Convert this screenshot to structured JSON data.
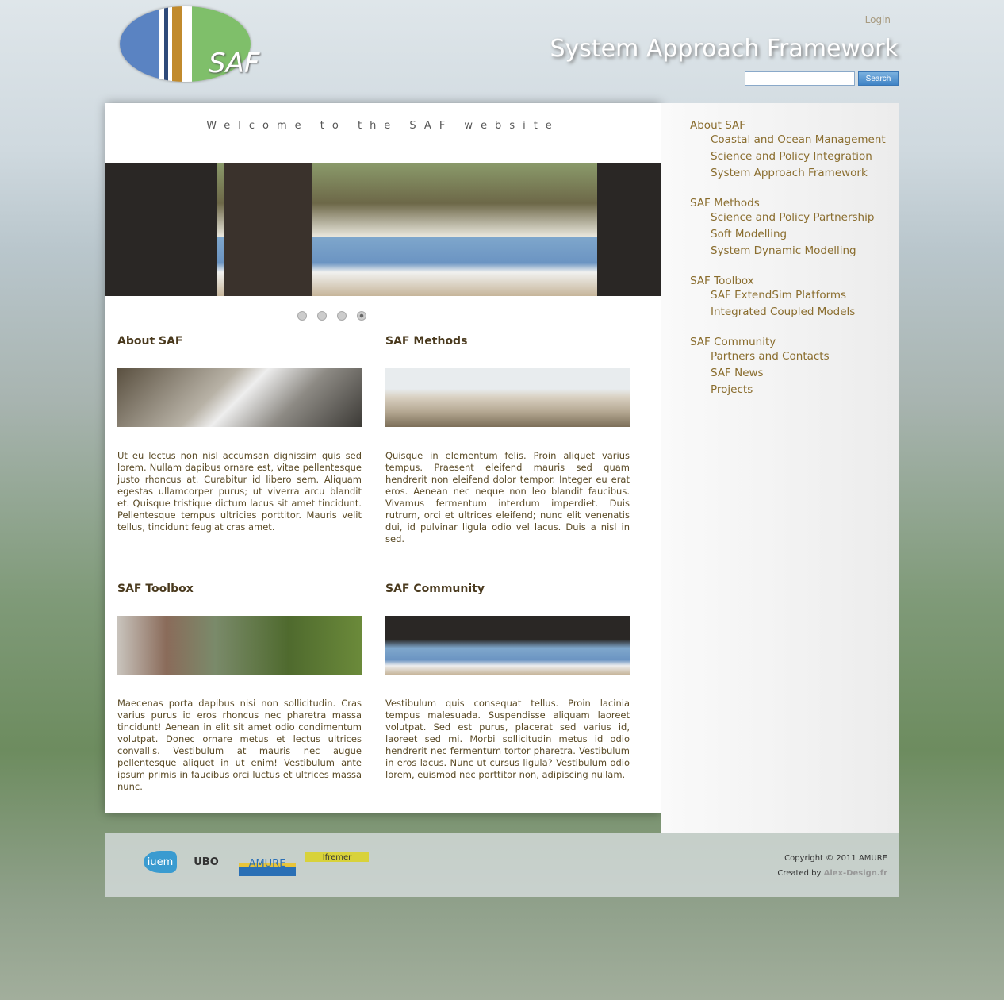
{
  "header": {
    "logo_text": "SAF",
    "login": "Login",
    "site_title": "System Approach Framework",
    "search_placeholder": "",
    "search_button": "Search"
  },
  "main": {
    "welcome": "Welcome to the SAF website",
    "slider_dots": 4,
    "active_dot": 4,
    "sections": [
      {
        "title": "About SAF",
        "text": "Ut eu lectus non nisl accumsan dignissim quis sed lorem. Nullam dapibus ornare est, vitae pellentesque justo rhoncus at. Curabitur id libero sem. Aliquam egestas ullamcorper purus; ut viverra arcu blandit et. Quisque tristique dictum lacus sit amet tincidunt. Pellentesque tempus ultricies porttitor. Mauris velit tellus, tincidunt feugiat cras amet."
      },
      {
        "title": "SAF Methods",
        "text": "Quisque in elementum felis. Proin aliquet varius tempus. Praesent eleifend mauris sed quam hendrerit non eleifend dolor tempor. Integer eu erat eros. Aenean nec neque non leo blandit faucibus. Vivamus fermentum interdum imperdiet. Duis rutrum, orci et ultrices eleifend; nunc elit venenatis dui, id pulvinar ligula odio vel lacus. Duis a nisl in sed."
      },
      {
        "title": "SAF Toolbox",
        "text": "Maecenas porta dapibus nisi non sollicitudin. Cras varius purus id eros rhoncus nec pharetra massa tincidunt! Aenean in elit sit amet odio condimentum volutpat. Donec ornare metus et lectus ultrices convallis. Vestibulum at mauris nec augue pellentesque aliquet in ut enim! Vestibulum ante ipsum primis in faucibus orci luctus et ultrices massa nunc."
      },
      {
        "title": "SAF Community",
        "text": "Vestibulum quis consequat tellus. Proin lacinia tempus malesuada. Suspendisse aliquam laoreet volutpat. Sed est purus, placerat sed varius id, laoreet sed mi. Morbi sollicitudin metus id odio hendrerit nec fermentum tortor pharetra. Vestibulum in eros lacus. Nunc ut cursus ligula? Vestibulum odio lorem, euismod nec porttitor non, adipiscing nullam."
      }
    ]
  },
  "sidebar": {
    "groups": [
      {
        "title": "About SAF",
        "items": [
          "Coastal and Ocean Management",
          "Science and Policy Integration",
          "System Approach Framework"
        ]
      },
      {
        "title": "SAF Methods",
        "items": [
          "Science and Policy Partnership",
          "Soft Modelling",
          "System Dynamic Modelling"
        ]
      },
      {
        "title": "SAF Toolbox",
        "items": [
          "SAF ExtendSim Platforms",
          "Integrated Coupled Models"
        ]
      },
      {
        "title": "SAF Community",
        "items": [
          "Partners and Contacts",
          "SAF News",
          "Projects"
        ]
      }
    ]
  },
  "footer": {
    "logos": [
      "iuem",
      "UBO",
      "AMURE",
      "Ifremer"
    ],
    "copyright": "Copyright © 2011 AMURE",
    "created_by": "Created by",
    "designer": "Alex-Design.fr"
  },
  "colors": {
    "nav_text": "#8a6d2e",
    "heading": "#4a3a1e",
    "search_button": "#4f90cf"
  }
}
